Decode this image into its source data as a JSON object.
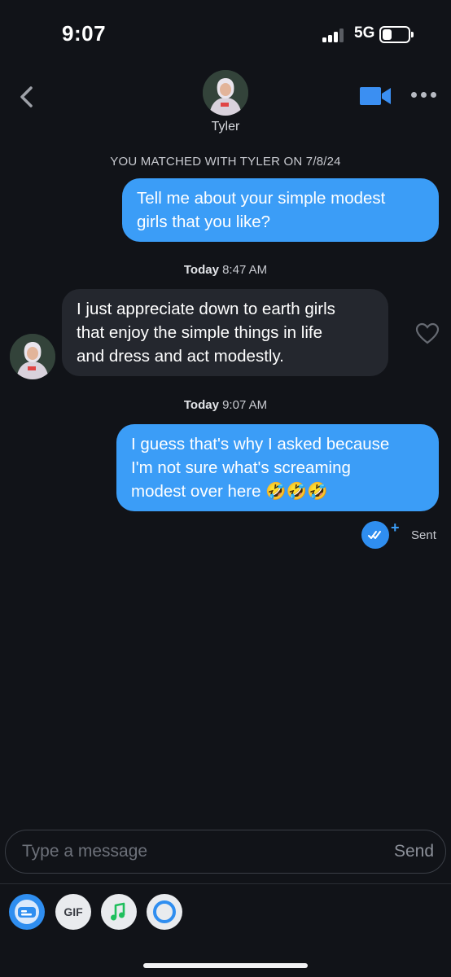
{
  "status_bar": {
    "time": "9:07",
    "network": "5G"
  },
  "header": {
    "contact_name": "Tyler"
  },
  "conversation": {
    "match_notice": "YOU MATCHED WITH TYLER ON 7/8/24",
    "messages": [
      {
        "direction": "outgoing",
        "text_lines": [
          "Tell me about your simple modest",
          "girls that you like?"
        ]
      },
      {
        "timestamp_day": "Today",
        "timestamp_time": "8:47 AM"
      },
      {
        "direction": "incoming",
        "text_lines": [
          "I just appreciate down to earth girls",
          "that enjoy the simple things in life",
          "and dress and act modestly."
        ]
      },
      {
        "timestamp_day": "Today",
        "timestamp_time": "9:07 AM"
      },
      {
        "direction": "outgoing",
        "text_lines": [
          "I guess that's why I asked because",
          "I'm not sure what's screaming",
          "modest over here 🤣🤣🤣"
        ]
      }
    ],
    "delivery_status": "Sent"
  },
  "composer": {
    "placeholder": "Type a message",
    "send_label": "Send"
  },
  "toolbar": {
    "gif_label": "GIF"
  },
  "colors": {
    "background": "#111318",
    "outgoing_bubble": "#3b9df7",
    "incoming_bubble": "#24272e",
    "accent": "#2f8ef0"
  }
}
